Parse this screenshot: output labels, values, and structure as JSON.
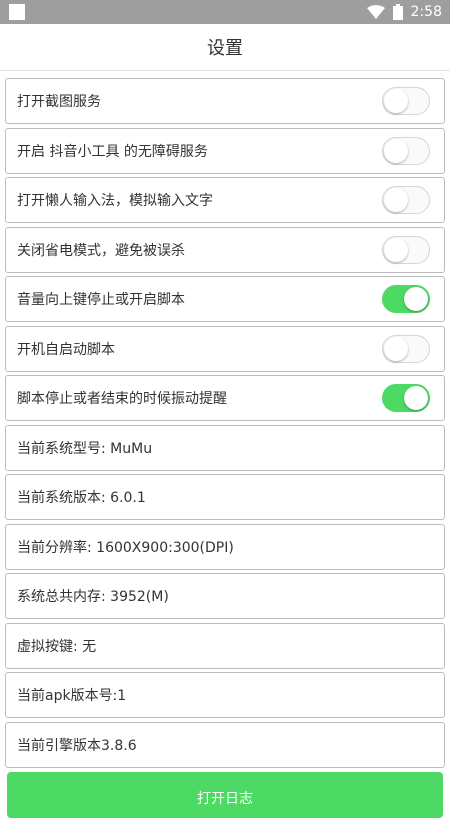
{
  "status_bar": {
    "time": "2:58"
  },
  "header": {
    "title": "设置"
  },
  "toggles": [
    {
      "label": "打开截图服务",
      "state": "off"
    },
    {
      "label": "开启 抖音小工具 的无障碍服务",
      "state": "off"
    },
    {
      "label": "打开懒人输入法，模拟输入文字",
      "state": "off"
    },
    {
      "label": "关闭省电模式，避免被误杀",
      "state": "off"
    },
    {
      "label": "音量向上键停止或开启脚本",
      "state": "on"
    },
    {
      "label": "开机自启动脚本",
      "state": "off"
    },
    {
      "label": "脚本停止或者结束的时候振动提醒",
      "state": "on"
    }
  ],
  "info": [
    {
      "label": "当前系统型号: MuMu"
    },
    {
      "label": "当前系统版本: 6.0.1"
    },
    {
      "label": "当前分辨率: 1600X900:300(DPI)"
    },
    {
      "label": "系统总共内存: 3952(M)"
    },
    {
      "label": "虚拟按键: 无"
    },
    {
      "label": "当前apk版本号:1"
    },
    {
      "label": "当前引擎版本3.8.6"
    }
  ],
  "actions": {
    "open_log_label": "打开日志"
  },
  "colors": {
    "accent": "#4cd964",
    "status_bar": "#9e9e9e"
  },
  "icons": {
    "wifi": "wifi-icon",
    "battery": "battery-icon"
  }
}
